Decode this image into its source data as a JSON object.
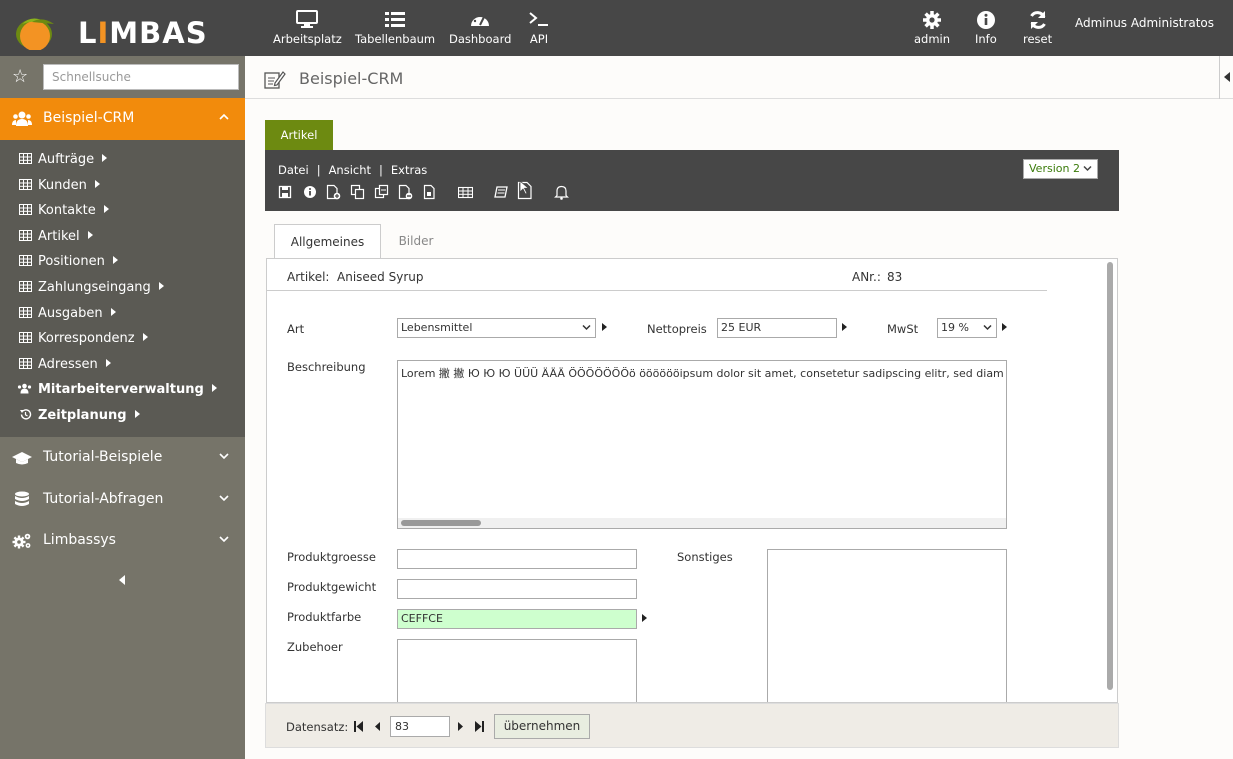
{
  "app": {
    "logo_text_1": "L",
    "logo_text_2": "I",
    "logo_text_3": "MBAS",
    "user": "Adminus Administratos"
  },
  "topnav": {
    "left": [
      {
        "label": "Arbeitsplatz",
        "icon": "monitor-icon"
      },
      {
        "label": "Tabellenbaum",
        "icon": "list-icon"
      },
      {
        "label": "Dashboard",
        "icon": "gauge-icon"
      },
      {
        "label": "API",
        "icon": "terminal-icon"
      }
    ],
    "right": [
      {
        "label": "admin",
        "icon": "gear-icon"
      },
      {
        "label": "Info",
        "icon": "info-icon"
      },
      {
        "label": "reset",
        "icon": "refresh-icon"
      }
    ]
  },
  "sidebar": {
    "search_placeholder": "Schnellsuche",
    "sections": [
      {
        "label": "Beispiel-CRM",
        "icon": "users-icon",
        "expanded": true
      },
      {
        "label": "Tutorial-Beispiele",
        "icon": "graduation-cap-icon",
        "expanded": false
      },
      {
        "label": "Tutorial-Abfragen",
        "icon": "database-icon",
        "expanded": false
      },
      {
        "label": "Limbassys",
        "icon": "gears-icon",
        "expanded": false
      }
    ],
    "items": [
      {
        "label": "Aufträge",
        "icon": "table-icon"
      },
      {
        "label": "Kunden",
        "icon": "table-icon"
      },
      {
        "label": "Kontakte",
        "icon": "table-icon"
      },
      {
        "label": "Artikel",
        "icon": "table-icon"
      },
      {
        "label": "Positionen",
        "icon": "table-icon"
      },
      {
        "label": "Zahlungseingang",
        "icon": "table-icon"
      },
      {
        "label": "Ausgaben",
        "icon": "table-icon"
      },
      {
        "label": "Korrespondenz",
        "icon": "table-icon"
      },
      {
        "label": "Adressen",
        "icon": "table-icon"
      },
      {
        "label": "Mitarbeiterverwaltung",
        "icon": "users-icon"
      },
      {
        "label": "Zeitplanung",
        "icon": "history-icon"
      }
    ]
  },
  "page": {
    "title": "Beispiel-CRM"
  },
  "form": {
    "tab": "Artikel",
    "menu": [
      "Datei",
      "Ansicht",
      "Extras"
    ],
    "menu_sep": "|",
    "version": "Version 2",
    "subtabs": [
      "Allgemeines",
      "Bilder"
    ],
    "header": {
      "artikel_label": "Artikel:",
      "artikel_value": "Aniseed Syrup",
      "anr_label": "ANr.:",
      "anr_value": "83"
    },
    "fields": {
      "art_label": "Art",
      "art_value": "Lebensmittel",
      "nettopreis_label": "Nettopreis",
      "nettopreis_value": "25 EUR",
      "mwst_label": "MwSt",
      "mwst_value": "19 %",
      "beschreibung_label": "Beschreibung",
      "beschreibung_value": "Lorem 撇 撇 Ю Ю Ю ÜÜÜ ÄÄÄ ÖÖÖÖÖÖÖö ööööööipsum dolor sit amet, consetetur sadipscing elitr, sed diam",
      "produktgroesse_label": "Produktgroesse",
      "produktgroesse_value": "",
      "produktgewicht_label": "Produktgewicht",
      "produktgewicht_value": "",
      "produktfarbe_label": "Produktfarbe",
      "produktfarbe_value": "CEFFCE",
      "zubehoer_label": "Zubehoer",
      "sonstiges_label": "Sonstiges"
    },
    "colors": {
      "produktfarbe_bg": "#ceffce",
      "accent_orange": "#f28b0c",
      "tab_green": "#6d8a11"
    }
  },
  "footer": {
    "datensatz_label": "Datensatz:",
    "record_value": "83",
    "apply_label": "übernehmen"
  }
}
